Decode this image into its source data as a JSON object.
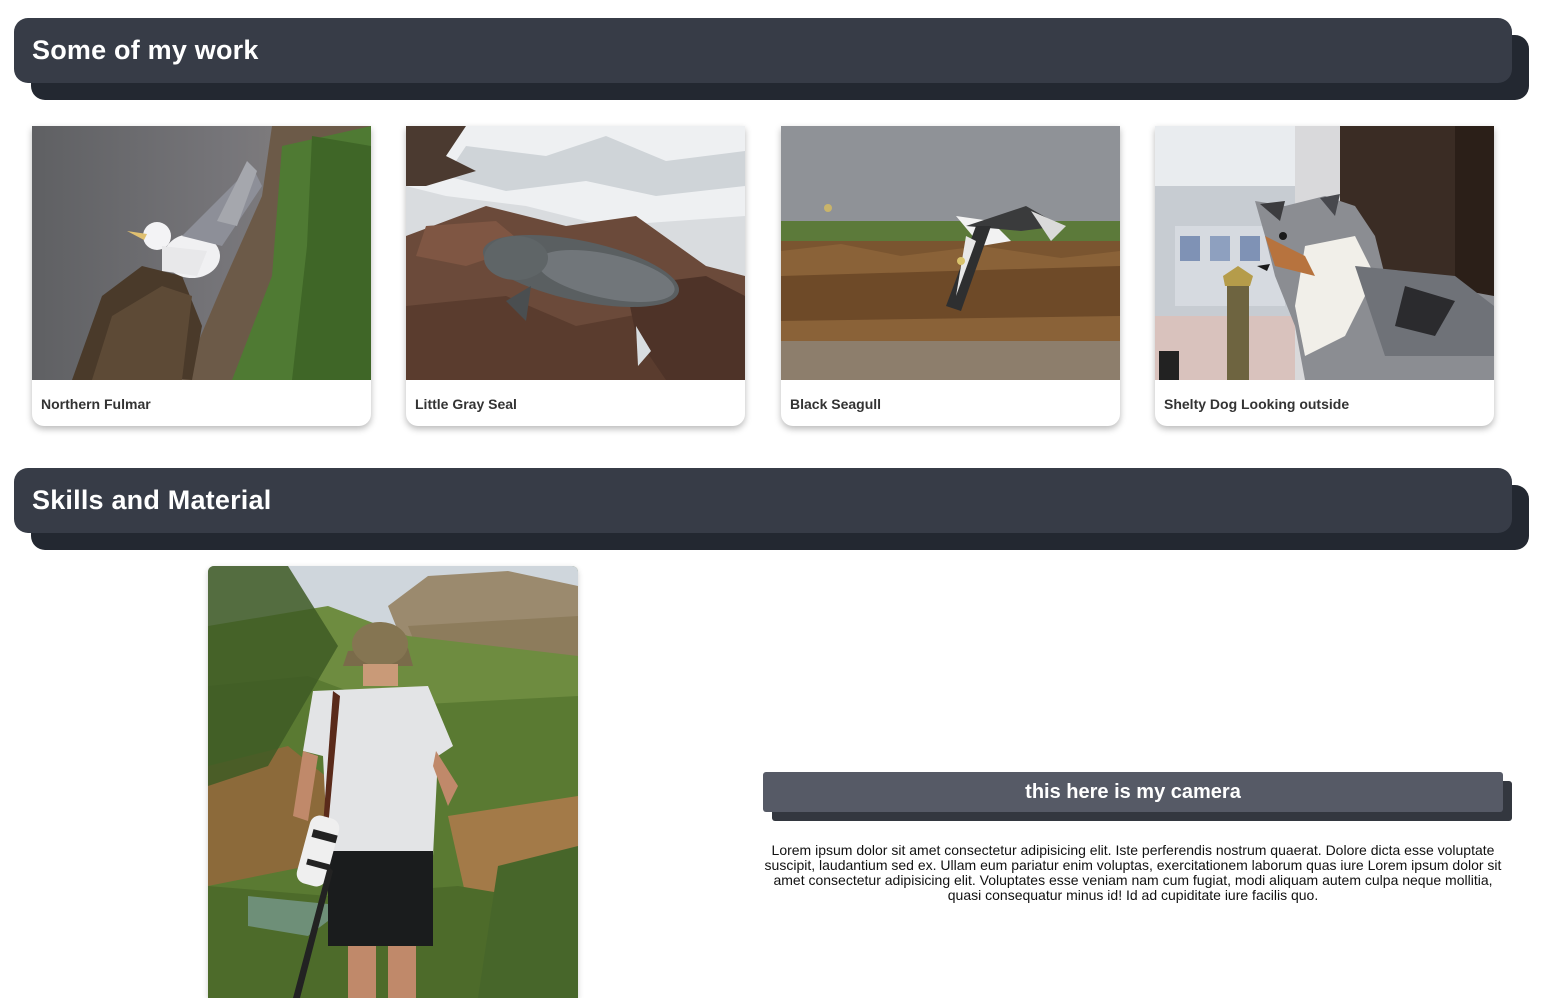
{
  "sections": {
    "work": {
      "title": "Some of my work"
    },
    "skills": {
      "title": "Skills and Material"
    }
  },
  "gallery": [
    {
      "caption": "Northern Fulmar",
      "image": "fulmar-photo"
    },
    {
      "caption": "Little Gray Seal",
      "image": "seal-photo"
    },
    {
      "caption": "Black Seagull",
      "image": "seagull-photo"
    },
    {
      "caption": "Shelty Dog Looking outside",
      "image": "dog-photo"
    }
  ],
  "skills": {
    "image": "photographer-photo",
    "camera_title": "this here is my camera",
    "description": "Lorem ipsum dolor sit amet consectetur adipisicing elit. Iste perferendis nostrum quaerat. Dolore dicta esse voluptate suscipit, laudantium sed ex. Ullam eum pariatur enim voluptas, exercitationem laborum quas iure Lorem ipsum dolor sit amet consectetur adipisicing elit. Voluptates esse veniam nam cum fugiat, modi aliquam autem culpa neque mollitia, quasi consequatur minus id! Id ad cupiditate iure facilis quo."
  },
  "colors": {
    "header_bg": "#373c47",
    "header_shadow": "#232831",
    "camera_bar": "#565a66",
    "camera_shadow": "#33373f"
  }
}
